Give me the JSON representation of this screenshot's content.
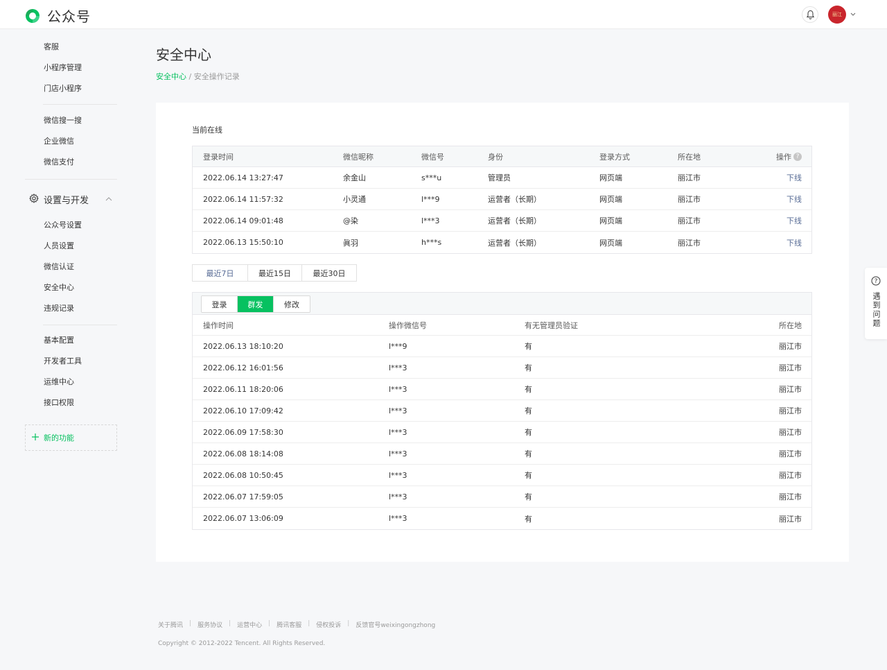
{
  "header": {
    "app_name": "公众号",
    "avatar_text": "丽江"
  },
  "sidebar": {
    "items": [
      {
        "label": "客服"
      },
      {
        "label": "小程序管理"
      },
      {
        "label": "门店小程序"
      },
      {
        "label": "微信搜一搜"
      },
      {
        "label": "企业微信"
      },
      {
        "label": "微信支付"
      },
      {
        "label": "公众号设置"
      },
      {
        "label": "人员设置"
      },
      {
        "label": "微信认证"
      },
      {
        "label": "安全中心"
      },
      {
        "label": "违规记录"
      },
      {
        "label": "基本配置"
      },
      {
        "label": "开发者工具"
      },
      {
        "label": "运维中心"
      },
      {
        "label": "接口权限"
      }
    ],
    "group_label": "设置与开发",
    "new_feature_label": "新的功能"
  },
  "page": {
    "title": "安全中心",
    "breadcrumb_link": "安全中心",
    "breadcrumb_sep": " / ",
    "breadcrumb_current": "安全操作记录"
  },
  "online": {
    "section_title": "当前在线",
    "columns": [
      "登录时间",
      "微信昵称",
      "微信号",
      "身份",
      "登录方式",
      "所在地",
      "操作"
    ],
    "rows": [
      {
        "time": "2022.06.14 13:27:47",
        "nickname": "余金山",
        "wxid": "s***u",
        "role": "管理员",
        "method": "网页端",
        "location": "丽江市",
        "action": "下线"
      },
      {
        "time": "2022.06.14 11:57:32",
        "nickname": "小灵通",
        "wxid": "l***9",
        "role": "运营者（长期）",
        "method": "网页端",
        "location": "丽江市",
        "action": "下线"
      },
      {
        "time": "2022.06.14 09:01:48",
        "nickname": "@染",
        "wxid": "l***3",
        "role": "运营者（长期）",
        "method": "网页端",
        "location": "丽江市",
        "action": "下线"
      },
      {
        "time": "2022.06.13 15:50:10",
        "nickname": "眞羽",
        "wxid": "h***s",
        "role": "运营者（长期）",
        "method": "网页端",
        "location": "丽江市",
        "action": "下线"
      }
    ]
  },
  "range_tabs": [
    "最近7日",
    "最近15日",
    "最近30日"
  ],
  "op_tabs": [
    "登录",
    "群发",
    "修改"
  ],
  "ops": {
    "columns": [
      "操作时间",
      "操作微信号",
      "有无管理员验证",
      "所在地"
    ],
    "rows": [
      {
        "time": "2022.06.13 18:10:20",
        "wxid": "l***9",
        "verified": "有",
        "location": "丽江市"
      },
      {
        "time": "2022.06.12 16:01:56",
        "wxid": "l***3",
        "verified": "有",
        "location": "丽江市"
      },
      {
        "time": "2022.06.11 18:20:06",
        "wxid": "l***3",
        "verified": "有",
        "location": "丽江市"
      },
      {
        "time": "2022.06.10 17:09:42",
        "wxid": "l***3",
        "verified": "有",
        "location": "丽江市"
      },
      {
        "time": "2022.06.09 17:58:30",
        "wxid": "l***3",
        "verified": "有",
        "location": "丽江市"
      },
      {
        "time": "2022.06.08 18:14:08",
        "wxid": "l***3",
        "verified": "有",
        "location": "丽江市"
      },
      {
        "time": "2022.06.08 10:50:45",
        "wxid": "l***3",
        "verified": "有",
        "location": "丽江市"
      },
      {
        "time": "2022.06.07 17:59:05",
        "wxid": "l***3",
        "verified": "有",
        "location": "丽江市"
      },
      {
        "time": "2022.06.07 13:06:09",
        "wxid": "l***3",
        "verified": "有",
        "location": "丽江市"
      }
    ]
  },
  "float_help": {
    "label": "遇到问题",
    "icon": "?"
  },
  "footer": {
    "links": [
      "关于腾讯",
      "服务协议",
      "运营中心",
      "腾讯客服",
      "侵权投诉",
      "反馈官号weixingongzhong"
    ],
    "copyright": "Copyright © 2012-2022 Tencent. All Rights Reserved."
  },
  "colors": {
    "brand_green": "#07c160",
    "link_blue": "#576b95",
    "avatar_red": "#c9252c"
  }
}
